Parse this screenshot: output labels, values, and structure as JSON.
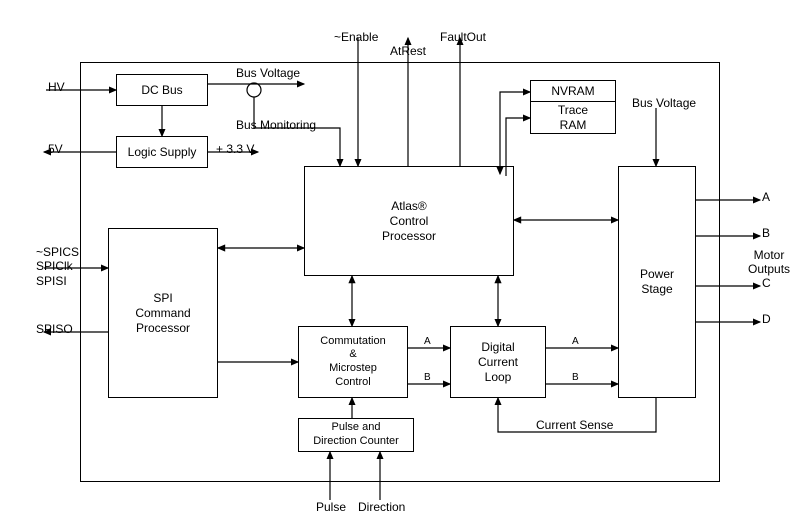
{
  "blocks": {
    "dc_bus": "DC Bus",
    "logic_supply": "Logic Supply",
    "spi_cmd": "SPI\nCommand\nProcessor",
    "atlas": "Atlas®\nControl\nProcessor",
    "commutation": "Commutation\n&\nMicrostep\nControl",
    "dcl": "Digital\nCurrent\nLoop",
    "pdc": "Pulse and\nDirection Counter",
    "nvram": "NVRAM",
    "trace_ram": "Trace\nRAM",
    "power_stage": "Power\nStage"
  },
  "signals": {
    "hv": "HV",
    "v5": "5V",
    "bus_voltage": "Bus Voltage",
    "bus_monitoring": "Bus Monitoring",
    "v33": "+ 3.3 V",
    "enable": "~Enable",
    "atrest": "AtRest",
    "faultout": "FaultOut",
    "spi_in": "~SPICS\nSPIClk\nSPISI",
    "spiso": "SPISO",
    "pulse": "Pulse",
    "direction": "Direction",
    "current_sense": "Current Sense",
    "bus_voltage2": "Bus Voltage",
    "motor_outputs": "Motor\nOutputs",
    "phase_a": "A",
    "phase_b": "B",
    "phase_c": "C",
    "phase_d": "D",
    "ab_a": "A",
    "ab_b": "B"
  }
}
